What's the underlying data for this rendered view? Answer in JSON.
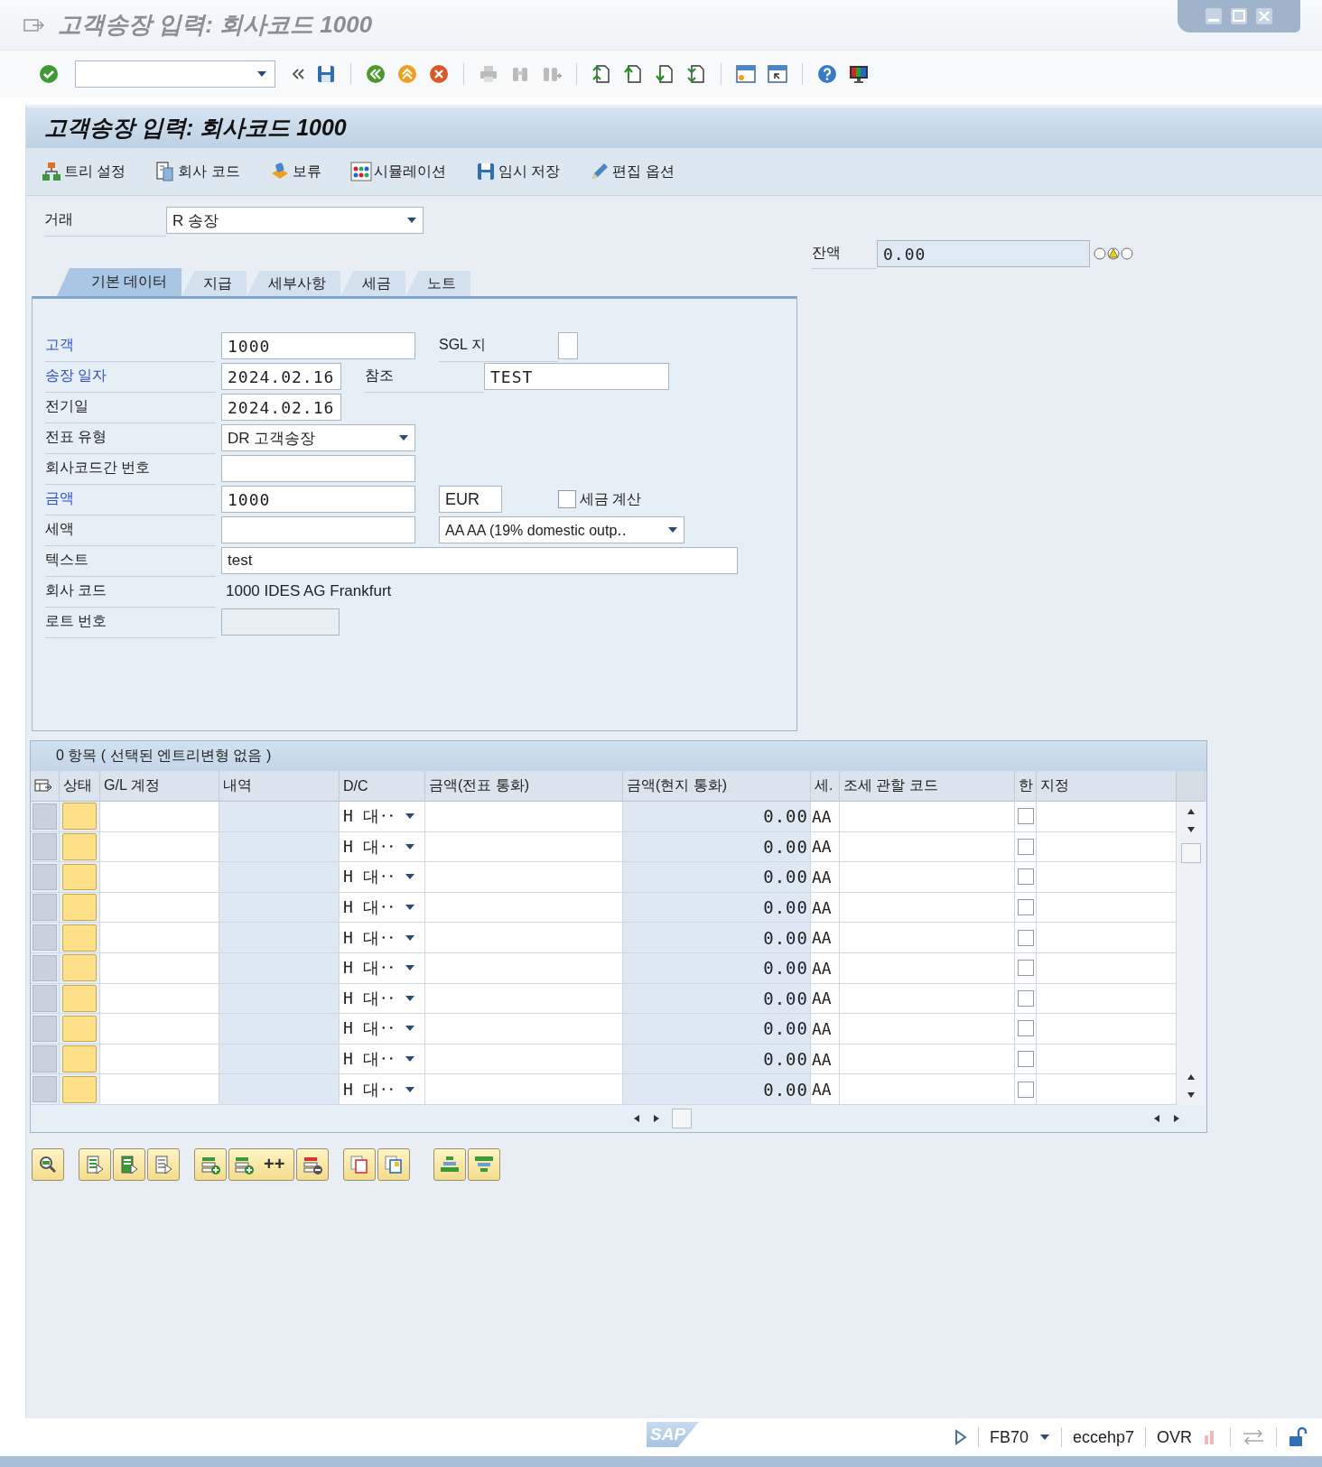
{
  "window": {
    "title": "고객송장 입력: 회사코드 1000"
  },
  "screen_title": "고객송장 입력: 회사코드 1000",
  "app_toolbar": [
    {
      "label": "트리 설정"
    },
    {
      "label": "회사 코드"
    },
    {
      "label": "보류"
    },
    {
      "label": "시뮬레이션"
    },
    {
      "label": "임시 저장"
    },
    {
      "label": "편집 옵션"
    }
  ],
  "transaction": {
    "label": "거래",
    "value": "R 송장"
  },
  "balance": {
    "label": "잔액",
    "value": "0.00"
  },
  "tabs": [
    {
      "label": "기본 데이터",
      "selected": true
    },
    {
      "label": "지급",
      "selected": false
    },
    {
      "label": "세부사항",
      "selected": false
    },
    {
      "label": "세금",
      "selected": false
    },
    {
      "label": "노트",
      "selected": false
    }
  ],
  "basic_data": [
    {
      "label": "고객",
      "required": true,
      "kind": "input",
      "value": "1000",
      "extras": [
        {
          "kind": "flag_field",
          "label": "SGL 지"
        }
      ]
    },
    {
      "label": "송장 일자",
      "required": true,
      "kind": "date",
      "value": "2024.02.16",
      "extras": [
        {
          "kind": "text_field",
          "label": "참조",
          "value": "TEST"
        }
      ]
    },
    {
      "label": "전기일",
      "required": false,
      "kind": "date",
      "value": "2024.02.16"
    },
    {
      "label": "전표 유형",
      "required": false,
      "kind": "dropdown",
      "value": "DR 고객송장"
    },
    {
      "label": "회사코드간 번호",
      "required": false,
      "kind": "input"
    },
    {
      "label": "금액",
      "required": true,
      "kind": "input",
      "value": "1000",
      "extras": [
        {
          "kind": "currency",
          "value": "EUR"
        },
        {
          "kind": "checkbox",
          "label": "세금 계산",
          "checked": false
        }
      ]
    },
    {
      "label": "세액",
      "required": false,
      "kind": "input",
      "extras": [
        {
          "kind": "dropdown",
          "value": "AA AA (19% domestic outp‥"
        }
      ]
    },
    {
      "label": "텍스트",
      "required": false,
      "kind": "wide_input",
      "value": "test"
    },
    {
      "label": "회사 코드",
      "required": false,
      "kind": "display",
      "value": "1000 IDES AG Frankfurt"
    },
    {
      "label": "로트 번호",
      "required": false,
      "kind": "readonly"
    }
  ],
  "items_table": {
    "title": "0 항목 ( 선택된 엔트리변형 없음 )",
    "columns": [
      "상태",
      "G/L 계정",
      "내역",
      "D/C",
      "금액(전표 통화)",
      "금액(현지 통화)",
      "세.",
      "조세 관할 코드",
      "한",
      "지정"
    ],
    "rows": [
      {
        "dc": "H 대‥",
        "local_amount": "0.00",
        "tax_code": "AA",
        "checked": false
      },
      {
        "dc": "H 대‥",
        "local_amount": "0.00",
        "tax_code": "AA",
        "checked": false
      },
      {
        "dc": "H 대‥",
        "local_amount": "0.00",
        "tax_code": "AA",
        "checked": false
      },
      {
        "dc": "H 대‥",
        "local_amount": "0.00",
        "tax_code": "AA",
        "checked": false
      },
      {
        "dc": "H 대‥",
        "local_amount": "0.00",
        "tax_code": "AA",
        "checked": false
      },
      {
        "dc": "H 대‥",
        "local_amount": "0.00",
        "tax_code": "AA",
        "checked": false
      },
      {
        "dc": "H 대‥",
        "local_amount": "0.00",
        "tax_code": "AA",
        "checked": false
      },
      {
        "dc": "H 대‥",
        "local_amount": "0.00",
        "tax_code": "AA",
        "checked": false
      },
      {
        "dc": "H 대‥",
        "local_amount": "0.00",
        "tax_code": "AA",
        "checked": false
      },
      {
        "dc": "H 대‥",
        "local_amount": "0.00",
        "tax_code": "AA",
        "checked": false
      }
    ]
  },
  "table_toolbar": {
    "insert_lines_label": "++"
  },
  "status_bar": {
    "logo": "SAP",
    "transaction": "FB70",
    "system": "eccehp7",
    "mode": "OVR"
  }
}
